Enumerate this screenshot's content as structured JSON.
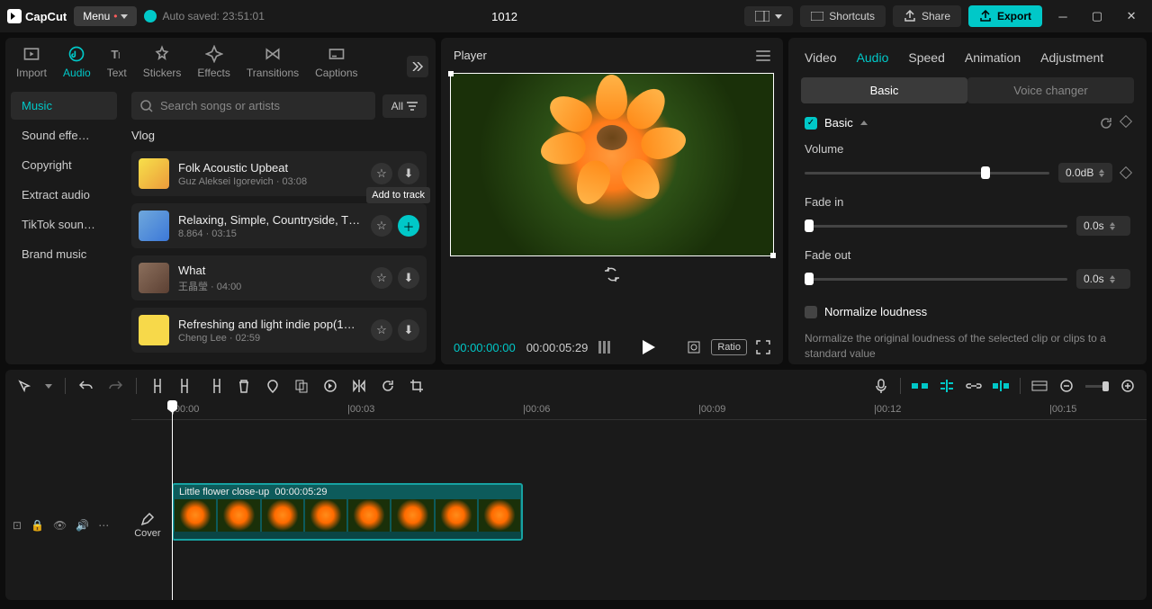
{
  "app": {
    "name": "CapCut"
  },
  "topbar": {
    "menu": "Menu",
    "auto_saved": "Auto saved: 23:51:01",
    "project_title": "1012",
    "shortcuts": "Shortcuts",
    "share": "Share",
    "export": "Export"
  },
  "media_tabs": [
    "Import",
    "Audio",
    "Text",
    "Stickers",
    "Effects",
    "Transitions",
    "Captions"
  ],
  "media_active_index": 1,
  "categories": [
    "Music",
    "Sound effe…",
    "Copyright",
    "Extract audio",
    "TikTok soun…",
    "Brand music"
  ],
  "category_active_index": 0,
  "search": {
    "placeholder": "Search songs or artists",
    "filter": "All"
  },
  "list_title": "Vlog",
  "tracks": [
    {
      "title": "Folk Acoustic Upbeat",
      "meta": "Guz Aleksei Igorevich · 03:08",
      "thumb": "yellow"
    },
    {
      "title": "Relaxing, Simple, Countryside, T…",
      "meta": "8.864 · 03:15",
      "thumb": "blue",
      "add": true,
      "tooltip": "Add to track"
    },
    {
      "title": "What",
      "meta": "王晶瑩 · 04:00",
      "thumb": "face"
    },
    {
      "title": "Refreshing and light indie pop(1…",
      "meta": "Cheng Lee · 02:59",
      "thumb": "yellow2"
    }
  ],
  "player": {
    "label": "Player",
    "current": "00:00:00:00",
    "total": "00:00:05:29",
    "ratio": "Ratio"
  },
  "inspector": {
    "tabs": [
      "Video",
      "Audio",
      "Speed",
      "Animation",
      "Adjustment"
    ],
    "active_index": 1,
    "sub_tabs": [
      "Basic",
      "Voice changer"
    ],
    "sub_active": 0,
    "section": "Basic",
    "volume": {
      "label": "Volume",
      "value": "0.0dB",
      "pos": 72
    },
    "fade_in": {
      "label": "Fade in",
      "value": "0.0s",
      "pos": 0
    },
    "fade_out": {
      "label": "Fade out",
      "value": "0.0s",
      "pos": 0
    },
    "normalize": {
      "label": "Normalize loudness",
      "desc": "Normalize the original loudness of the selected clip or clips to a standard value"
    }
  },
  "timeline": {
    "marks": [
      "|00:00",
      "|00:03",
      "|00:06",
      "|00:09",
      "|00:12",
      "|00:15"
    ],
    "clip": {
      "label": "Little flower close-up",
      "duration": "00:00:05:29"
    },
    "cover": "Cover"
  }
}
